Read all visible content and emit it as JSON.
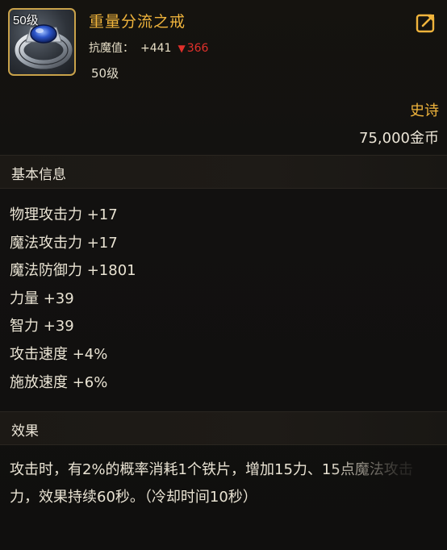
{
  "item": {
    "icon_level": "50级",
    "name": "重量分流之戒",
    "stat_label": "抗魔值：",
    "stat_plus": "+441",
    "stat_arrow": "▼",
    "stat_minus": "366",
    "required_level": "50级",
    "rarity": "史诗",
    "price": "75,000金币"
  },
  "base_info": {
    "title": "基本信息",
    "stats": [
      "物理攻击力 +17",
      "魔法攻击力 +17",
      "魔法防御力 +1801",
      "力量 +39",
      "智力 +39",
      "攻击速度 +4%",
      "施放速度 +6%"
    ]
  },
  "effect": {
    "title": "效果",
    "text": "攻击时，有2%的概率消耗1个铁片，增加15力、15点魔法攻击力，效果持续60秒。（冷却时间10秒）"
  },
  "colors": {
    "gold": "#f0b43c",
    "down_red": "#e0302b",
    "text": "#e9e3d3"
  },
  "icons": {
    "item": "ring-icon",
    "share": "share-icon"
  }
}
